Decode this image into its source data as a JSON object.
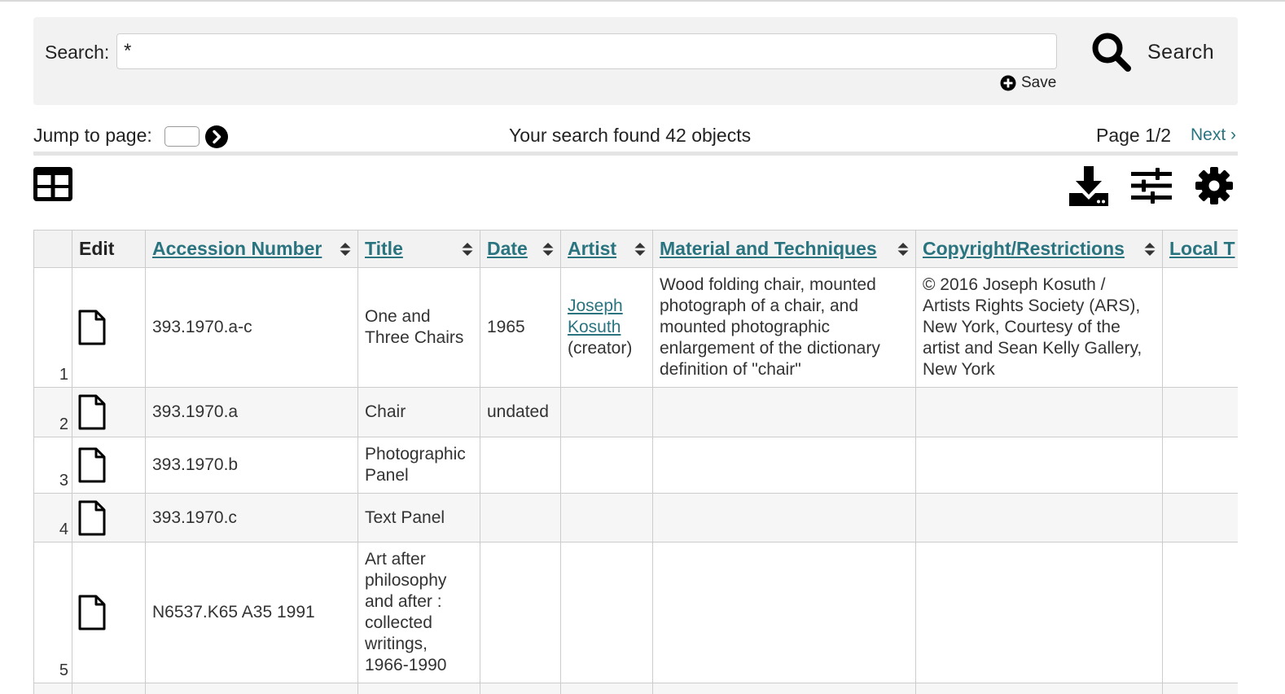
{
  "search": {
    "label": "Search:",
    "value": "*",
    "button_label": "Search",
    "save_label": "Save"
  },
  "pager": {
    "jump_label": "Jump to page:",
    "found_text": "Your search found 42 objects",
    "page_indicator": "Page 1/2",
    "next_label": "Next ›"
  },
  "toolbar": {
    "icons": [
      "table-view-icon",
      "download-icon",
      "sliders-icon",
      "gear-icon"
    ]
  },
  "table": {
    "columns": [
      {
        "label": "",
        "sortable": false
      },
      {
        "label": "Edit",
        "sortable": false
      },
      {
        "label": "Accession Number",
        "sortable": true
      },
      {
        "label": "Title",
        "sortable": true
      },
      {
        "label": "Date",
        "sortable": true
      },
      {
        "label": "Artist",
        "sortable": true
      },
      {
        "label": "Material and Techniques",
        "sortable": true
      },
      {
        "label": "Copyright/Restrictions",
        "sortable": true
      },
      {
        "label": "Local T",
        "sortable": true
      }
    ],
    "rows": [
      {
        "num": "1",
        "accession": "393.1970.a-c",
        "title": "One and Three Chairs",
        "date": "1965",
        "artist_name": "Joseph Kosuth",
        "artist_role": "(creator)",
        "material": "Wood folding chair, mounted photograph of a chair, and mounted photographic enlargement of the dictionary definition of \"chair\"",
        "copyright": "© 2016 Joseph Kosuth / Artists Rights Society (ARS), New York, Courtesy of the artist and Sean Kelly Gallery, New York",
        "local": ""
      },
      {
        "num": "2",
        "accession": "393.1970.a",
        "title": "Chair",
        "date": "undated",
        "artist_name": "",
        "artist_role": "",
        "material": "",
        "copyright": "",
        "local": ""
      },
      {
        "num": "3",
        "accession": "393.1970.b",
        "title": "Photographic Panel",
        "date": "",
        "artist_name": "",
        "artist_role": "",
        "material": "",
        "copyright": "",
        "local": ""
      },
      {
        "num": "4",
        "accession": "393.1970.c",
        "title": "Text Panel",
        "date": "",
        "artist_name": "",
        "artist_role": "",
        "material": "",
        "copyright": "",
        "local": ""
      },
      {
        "num": "5",
        "accession": "N6537.K65 A35 1991",
        "title": "Art after philosophy and after : collected writings, 1966-1990",
        "date": "",
        "artist_name": "",
        "artist_role": "",
        "material": "",
        "copyright": "",
        "local": ""
      }
    ]
  },
  "colors": {
    "link": "#2a7480",
    "panel_bg": "#f2f2f2",
    "border": "#cccccc",
    "text": "#222222"
  }
}
